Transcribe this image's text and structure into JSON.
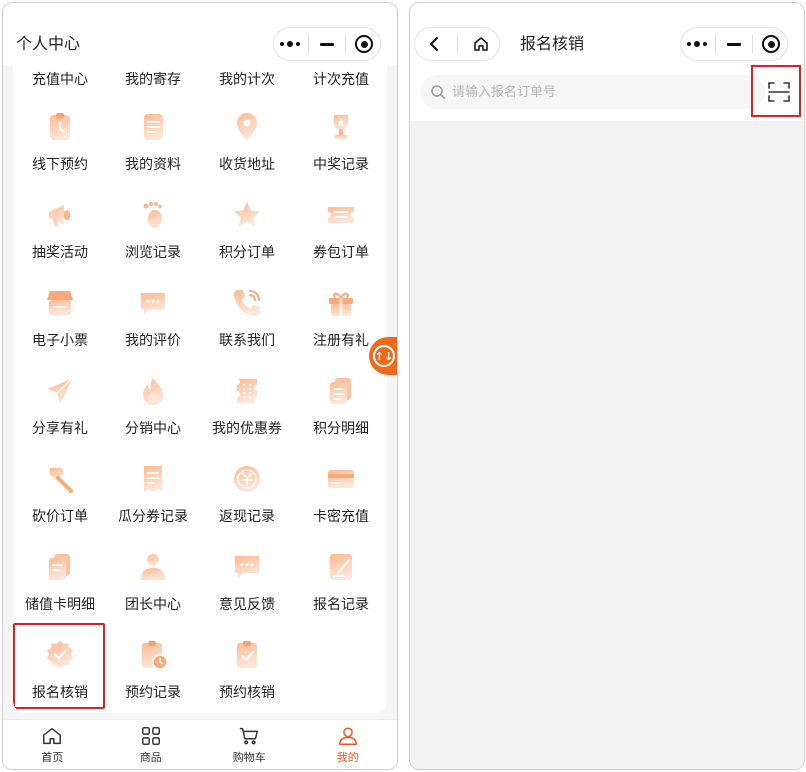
{
  "colors": {
    "accent": "#f0541e",
    "icon_gradient_from": "#ffb990",
    "icon_gradient_to": "#fde6d8",
    "highlight": "#e0201c"
  },
  "left": {
    "title": "个人中心",
    "top_row": [
      "充值中心",
      "我的寄存",
      "我的计次",
      "计次充值"
    ],
    "items": [
      {
        "label": "线下预约",
        "icon": "clipboard-clock-icon"
      },
      {
        "label": "我的资料",
        "icon": "document-icon"
      },
      {
        "label": "收货地址",
        "icon": "location-pin-icon"
      },
      {
        "label": "中奖记录",
        "icon": "trophy-icon"
      },
      {
        "label": "抽奖活动",
        "icon": "megaphone-icon"
      },
      {
        "label": "浏览记录",
        "icon": "footprint-icon"
      },
      {
        "label": "积分订单",
        "icon": "star-icon"
      },
      {
        "label": "券包订单",
        "icon": "ticket-icon"
      },
      {
        "label": "电子小票",
        "icon": "shop-icon"
      },
      {
        "label": "我的评价",
        "icon": "chat-icon"
      },
      {
        "label": "联系我们",
        "icon": "phone-icon"
      },
      {
        "label": "注册有礼",
        "icon": "gift-icon"
      },
      {
        "label": "分享有礼",
        "icon": "send-icon"
      },
      {
        "label": "分销中心",
        "icon": "flame-icon"
      },
      {
        "label": "我的优惠券",
        "icon": "coupon-icon"
      },
      {
        "label": "积分明细",
        "icon": "list-icon"
      },
      {
        "label": "砍价订单",
        "icon": "axe-icon"
      },
      {
        "label": "瓜分券记录",
        "icon": "bill-icon"
      },
      {
        "label": "返现记录",
        "icon": "coin-icon"
      },
      {
        "label": "卡密充值",
        "icon": "card-icon"
      },
      {
        "label": "储值卡明细",
        "icon": "cards-icon"
      },
      {
        "label": "团长中心",
        "icon": "person-icon"
      },
      {
        "label": "意见反馈",
        "icon": "feedback-icon"
      },
      {
        "label": "报名记录",
        "icon": "edit-note-icon"
      },
      {
        "label": "报名核销",
        "icon": "badge-check-icon"
      },
      {
        "label": "预约记录",
        "icon": "clipboard-time-icon"
      },
      {
        "label": "预约核销",
        "icon": "clipboard-check-icon"
      }
    ],
    "float_button_icon": "swap-icon",
    "float_button_text": "↑↓",
    "tabs": [
      {
        "label": "首页",
        "icon": "home-icon"
      },
      {
        "label": "商品",
        "icon": "grid-icon"
      },
      {
        "label": "购物车",
        "icon": "cart-icon"
      },
      {
        "label": "我的",
        "icon": "user-icon",
        "active": true
      }
    ]
  },
  "right": {
    "title": "报名核销",
    "search": {
      "placeholder": "请输入报名订单号",
      "value": ""
    }
  }
}
